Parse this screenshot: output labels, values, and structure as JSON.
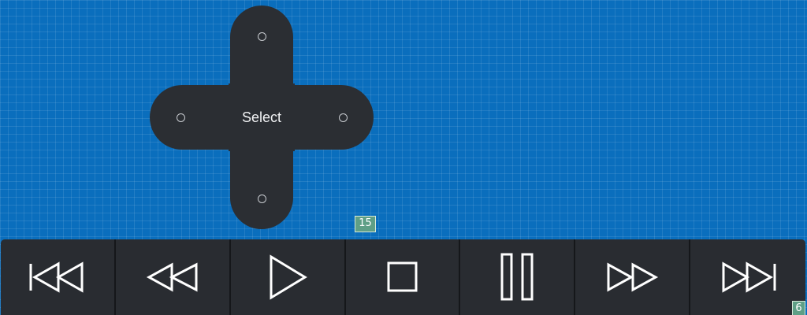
{
  "dpad": {
    "select_label": "Select",
    "directions": [
      "up",
      "down",
      "left",
      "right"
    ]
  },
  "badges": {
    "top": "15",
    "corner": "6"
  },
  "transport": {
    "buttons": [
      {
        "action": "skip-back",
        "icon": "skip-back-icon"
      },
      {
        "action": "rewind",
        "icon": "rewind-icon"
      },
      {
        "action": "play",
        "icon": "play-icon"
      },
      {
        "action": "stop",
        "icon": "stop-icon"
      },
      {
        "action": "pause",
        "icon": "pause-icon"
      },
      {
        "action": "fast-forward",
        "icon": "fast-forward-icon"
      },
      {
        "action": "skip-forward",
        "icon": "skip-forward-icon"
      }
    ]
  },
  "colors": {
    "background": "#0a6ebd",
    "panel": "#2b2e33",
    "badge": "#5f9f86",
    "icon_stroke": "#ffffff"
  }
}
